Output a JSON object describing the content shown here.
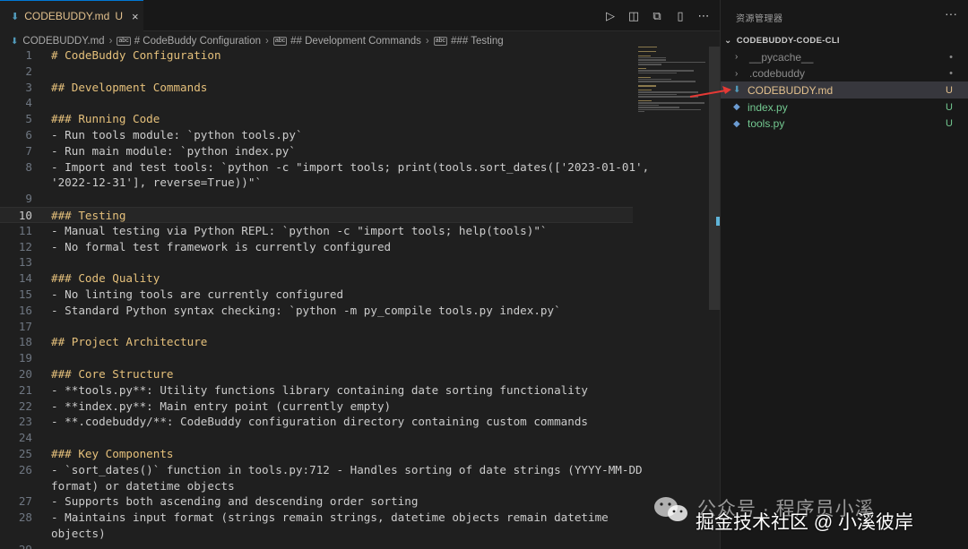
{
  "tab": {
    "icon": "markdown-icon",
    "title": "CODEBUDDY.md",
    "status": "U",
    "close": "×"
  },
  "editor_actions": [
    {
      "name": "run-icon",
      "glyph": "▷"
    },
    {
      "name": "open-preview-icon",
      "glyph": "◫"
    },
    {
      "name": "compare-changes-icon",
      "glyph": "⧉"
    },
    {
      "name": "split-editor-icon",
      "glyph": "▯"
    },
    {
      "name": "more-actions-icon",
      "glyph": "⋯"
    }
  ],
  "breadcrumb": [
    "CODEBUDDY.md",
    "# CodeBuddy Configuration",
    "## Development Commands",
    "### Testing"
  ],
  "lines": [
    {
      "n": "1",
      "text": "# CodeBuddy Configuration",
      "kind": "h"
    },
    {
      "n": "2",
      "text": "",
      "kind": "p"
    },
    {
      "n": "3",
      "text": "## Development Commands",
      "kind": "h"
    },
    {
      "n": "4",
      "text": "",
      "kind": "p"
    },
    {
      "n": "5",
      "text": "### Running Code",
      "kind": "h"
    },
    {
      "n": "6",
      "text": "- Run tools module: `python tools.py`",
      "kind": "p"
    },
    {
      "n": "7",
      "text": "- Run main module: `python index.py`",
      "kind": "p"
    },
    {
      "n": "8",
      "text": "- Import and test tools: `python -c \"import tools; print(tools.sort_dates(['2023-01-01',",
      "kind": "p"
    },
    {
      "n": "",
      "text": "'2022-12-31'], reverse=True))\"`",
      "kind": "p"
    },
    {
      "n": "9",
      "text": "",
      "kind": "p"
    },
    {
      "n": "10",
      "text": "### Testing",
      "kind": "h",
      "current": true
    },
    {
      "n": "11",
      "text": "- Manual testing via Python REPL: `python -c \"import tools; help(tools)\"`",
      "kind": "p"
    },
    {
      "n": "12",
      "text": "- No formal test framework is currently configured",
      "kind": "p"
    },
    {
      "n": "13",
      "text": "",
      "kind": "p"
    },
    {
      "n": "14",
      "text": "### Code Quality",
      "kind": "h"
    },
    {
      "n": "15",
      "text": "- No linting tools are currently configured",
      "kind": "p"
    },
    {
      "n": "16",
      "text": "- Standard Python syntax checking: `python -m py_compile tools.py index.py`",
      "kind": "p"
    },
    {
      "n": "17",
      "text": "",
      "kind": "p"
    },
    {
      "n": "18",
      "text": "## Project Architecture",
      "kind": "h"
    },
    {
      "n": "19",
      "text": "",
      "kind": "p"
    },
    {
      "n": "20",
      "text": "### Core Structure",
      "kind": "h"
    },
    {
      "n": "21",
      "text": "- **tools.py**: Utility functions library containing date sorting functionality",
      "kind": "p"
    },
    {
      "n": "22",
      "text": "- **index.py**: Main entry point (currently empty)",
      "kind": "p"
    },
    {
      "n": "23",
      "text": "- **.codebuddy/**: CodeBuddy configuration directory containing custom commands",
      "kind": "p"
    },
    {
      "n": "24",
      "text": "",
      "kind": "p"
    },
    {
      "n": "25",
      "text": "### Key Components",
      "kind": "h"
    },
    {
      "n": "26",
      "text": "- `sort_dates()` function in tools.py:712 - Handles sorting of date strings (YYYY-MM-DD",
      "kind": "p"
    },
    {
      "n": "",
      "text": "format) or datetime objects",
      "kind": "p"
    },
    {
      "n": "27",
      "text": "- Supports both ascending and descending order sorting",
      "kind": "p"
    },
    {
      "n": "28",
      "text": "- Maintains input format (strings remain strings, datetime objects remain datetime",
      "kind": "p"
    },
    {
      "n": "",
      "text": "objects)",
      "kind": "p"
    },
    {
      "n": "29",
      "text": "",
      "kind": "p"
    }
  ],
  "explorer": {
    "title": "资源管理器",
    "more": "···",
    "root": "CODEBUDDY-CODE-CLI",
    "items": [
      {
        "name": "__pycache__",
        "type": "folder",
        "status": "•",
        "color": "c-gray",
        "icon_name": "chevron-right-icon"
      },
      {
        "name": ".codebuddy",
        "type": "folder",
        "status": "•",
        "color": "c-gray",
        "icon_name": "chevron-right-icon"
      },
      {
        "name": "CODEBUDDY.md",
        "type": "file",
        "status": "U",
        "color": "c-yellow",
        "icon_name": "markdown-icon",
        "active": true
      },
      {
        "name": "index.py",
        "type": "file",
        "status": "U",
        "color": "c-green",
        "icon_name": "python-icon"
      },
      {
        "name": "tools.py",
        "type": "file",
        "status": "U",
        "color": "c-green",
        "icon_name": "python-icon"
      }
    ]
  },
  "watermark": {
    "line1": "公众号 · 程序员小溪",
    "line2": "掘金技术社区 @ 小溪彼岸"
  }
}
